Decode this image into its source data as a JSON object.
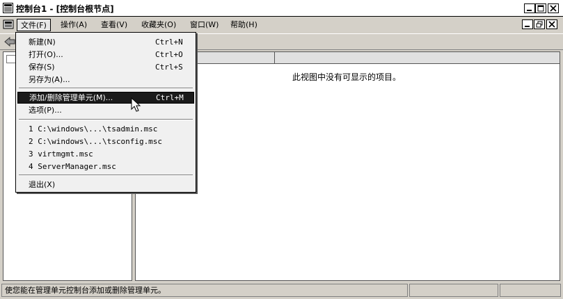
{
  "window": {
    "title": "控制台1 - [控制台根节点]"
  },
  "menubar": {
    "items": [
      {
        "label": "文件(F)"
      },
      {
        "label": "操作(A)"
      },
      {
        "label": "查看(V)"
      },
      {
        "label": "收藏夹(O)"
      },
      {
        "label": "窗口(W)"
      },
      {
        "label": "帮助(H)"
      }
    ]
  },
  "file_menu": {
    "items": [
      {
        "label": "新建(N)",
        "shortcut": "Ctrl+N"
      },
      {
        "label": "打开(O)...",
        "shortcut": "Ctrl+O"
      },
      {
        "label": "保存(S)",
        "shortcut": "Ctrl+S"
      },
      {
        "label": "另存为(A)...",
        "shortcut": ""
      },
      {
        "label": "添加/删除管理单元(M)...",
        "shortcut": "Ctrl+M"
      },
      {
        "label": "选项(P)...",
        "shortcut": ""
      },
      {
        "label": "1 C:\\windows\\...\\tsadmin.msc",
        "shortcut": ""
      },
      {
        "label": "2 C:\\windows\\...\\tsconfig.msc",
        "shortcut": ""
      },
      {
        "label": "3 virtmgmt.msc",
        "shortcut": ""
      },
      {
        "label": "4 ServerManager.msc",
        "shortcut": ""
      },
      {
        "label": "退出(X)",
        "shortcut": ""
      }
    ]
  },
  "right_pane": {
    "empty_message": "此视图中没有可显示的项目。"
  },
  "statusbar": {
    "text": "使您能在管理单元控制台添加或删除管理单元。"
  },
  "colors": {
    "chrome": "#d4d0c8",
    "highlight": "#1a1a1a"
  }
}
